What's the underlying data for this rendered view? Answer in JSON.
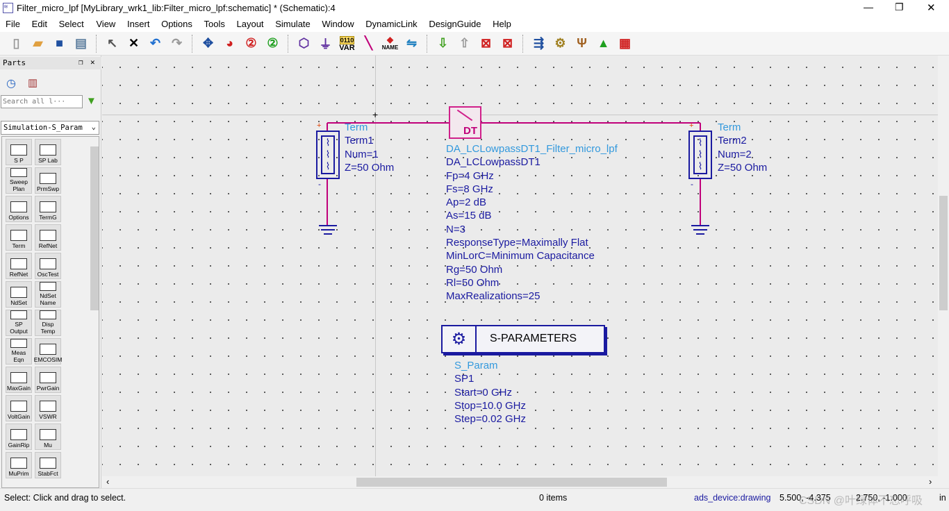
{
  "window": {
    "title": "Filter_micro_lpf [MyLibrary_wrk1_lib:Filter_micro_lpf:schematic] * (Schematic):4",
    "controls": [
      "—",
      "❐",
      "✕"
    ]
  },
  "menu": [
    "File",
    "Edit",
    "Select",
    "View",
    "Insert",
    "Options",
    "Tools",
    "Layout",
    "Simulate",
    "Window",
    "DynamicLink",
    "DesignGuide",
    "Help"
  ],
  "toolbar": {
    "icons": [
      "new-icon",
      "open-icon",
      "save-icon",
      "print-icon",
      "select-arrow-icon",
      "delete-icon",
      "undo-icon",
      "redo-icon",
      "pan-icon",
      "zoom-area-icon",
      "zoom-in-icon",
      "zoom-out-icon",
      "port-icon",
      "ground-icon",
      "var-icon",
      "wire-icon",
      "name-icon",
      "insert-pin-icon",
      "push-into-icon",
      "pop-out-icon",
      "deactivate-icon",
      "short-icon",
      "simulate-setup-icon",
      "tune-icon",
      "optimize-icon",
      "up-arrow-icon",
      "display-data-icon"
    ],
    "var_label": "VAR",
    "var_bits": "0110",
    "name_label": "NAME"
  },
  "parts": {
    "title": "Parts",
    "search_placeholder": "Search all l···",
    "library": "Simulation-S_Param",
    "items": [
      "S P",
      "SP Lab",
      "Sweep Plan",
      "PrmSwp",
      "Options",
      "TermG",
      "Term",
      "RefNet",
      "RefNet",
      "OscTest",
      "NdSet",
      "NdSet Name",
      "SP Output",
      "Disp Temp",
      "Meas Eqn",
      "EMCOSIM",
      "MaxGain",
      "PwrGain",
      "VoltGain",
      "VSWR",
      "GainRip",
      "Mu",
      "MuPrim",
      "StabFct"
    ]
  },
  "schematic": {
    "term1": {
      "type": "Term",
      "name": "Term1",
      "num": "Num=1",
      "z": "Z=50 Ohm"
    },
    "term2": {
      "type": "Term",
      "name": "Term2",
      "num": "Num=2",
      "z": "Z=50 Ohm"
    },
    "dt": {
      "symbol": "DT",
      "type": "DA_LCLowpassDT1_Filter_micro_lpf",
      "params": [
        "DA_LCLowpassDT1",
        "Fp=4 GHz",
        "Fs=8 GHz",
        "Ap=2 dB",
        "As=15 dB",
        "N=3",
        "ResponseType=Maximally Flat",
        "MinLorC=Minimum Capacitance",
        "Rg=50 Ohm",
        "Rl=50 Ohm",
        "MaxRealizations=25"
      ]
    },
    "sparam": {
      "label": "S-PARAMETERS",
      "type": "S_Param",
      "params": [
        "SP1",
        "Start=0 GHz",
        "Stop=10.0 GHz",
        "Step=0.02 GHz"
      ]
    }
  },
  "status": {
    "message": "Select: Click and drag to select.",
    "items": "0 items",
    "layer": "ads_device:drawing",
    "coords": "5.500, -4.375",
    "coords2": "2.750, -1.000",
    "unit": "in",
    "watermark": "CSDN @叶绿体不忘呼吸"
  },
  "colors": {
    "wire": "#c0007a",
    "component": "#1a1aa0",
    "type_label": "#3399dd",
    "sparam_border": "#1a1aa0"
  }
}
